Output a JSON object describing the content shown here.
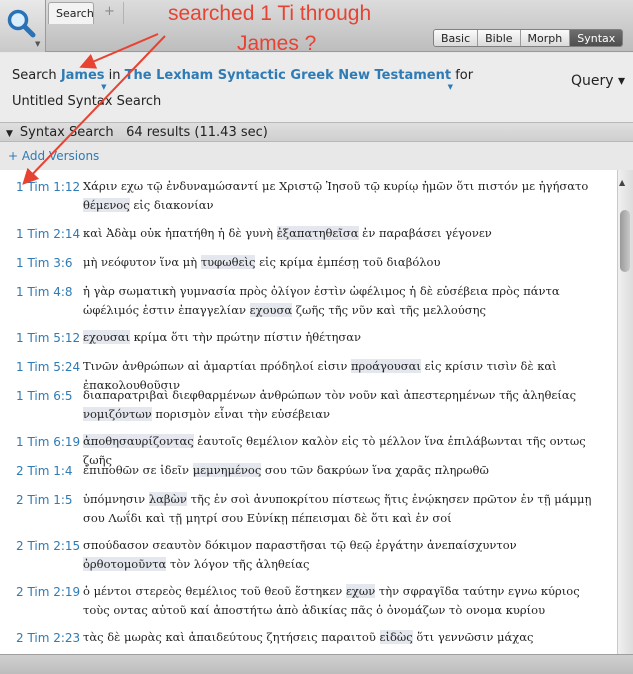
{
  "toolbar": {
    "tab_label": "Search",
    "add_tab": "+",
    "view_modes": [
      "Basic",
      "Bible",
      "Morph",
      "Syntax"
    ],
    "active_view": "Syntax"
  },
  "annotation": {
    "line1": "searched 1 Ti through",
    "line2": "James ?"
  },
  "query": {
    "search_label": "Search",
    "range": "James",
    "in_label": "in",
    "resource": "The Lexham Syntactic Greek New Testament",
    "for_label": "for",
    "query_name": "Untitled Syntax Search",
    "query_menu": "Query ▾"
  },
  "section": {
    "title": "Syntax Search",
    "summary": "64 results (11.43 sec)",
    "add_versions": "+ Add Versions"
  },
  "results": [
    {
      "ref": "1 Tim 1:12",
      "segments": [
        [
          "Χάριν εχω τῷ ἐνδυναμώσαντί με Χριστῷ Ἰησοῦ τῷ κυρίῳ ἡμῶν ὅτι πιστόν με ἡγήσατο ",
          false
        ],
        [
          "θέμενος",
          true
        ],
        [
          " εἰς διακονίαν",
          false
        ]
      ]
    },
    {
      "ref": "1 Tim 2:14",
      "segments": [
        [
          "καὶ Ἀδὰμ οὐκ ἠπατήθη ἡ δὲ γυνὴ ",
          false
        ],
        [
          "ἐξαπατηθεῖσα",
          true
        ],
        [
          " ἐν παραβάσει γέγονεν",
          false
        ]
      ]
    },
    {
      "ref": "1 Tim 3:6",
      "segments": [
        [
          "μὴ νεόφυτον ἵνα μὴ ",
          false
        ],
        [
          "τυφωθεὶς",
          true
        ],
        [
          " εἰς κρίμα ἐμπέσῃ τοῦ διαβόλου",
          false
        ]
      ]
    },
    {
      "ref": "1 Tim 4:8",
      "segments": [
        [
          "ἡ γὰρ σωματικὴ γυμνασία πρὸς ὀλίγον ἐστὶν ὠφέλιμος ἡ δὲ εὐσέβεια πρὸς πάντα ὠφέλιμός ἐστιν ἐπαγγελίαν ",
          false
        ],
        [
          "εχουσα",
          true
        ],
        [
          " ζωῆς τῆς νῦν καὶ τῆς μελλούσης",
          false
        ]
      ]
    },
    {
      "ref": "1 Tim 5:12",
      "segments": [
        [
          "εχουσαι",
          true
        ],
        [
          " κρίμα ὅτι τὴν πρώτην πίστιν ἠθέτησαν",
          false
        ]
      ]
    },
    {
      "ref": "1 Tim 5:24",
      "segments": [
        [
          "Τινῶν ἀνθρώπων αἱ ἁμαρτίαι πρόδηλοί εἰσιν ",
          false
        ],
        [
          "προάγουσαι",
          true
        ],
        [
          " εἰς κρίσιν τισὶν δὲ καὶ ἐπακολουθοῦσιν",
          false
        ]
      ]
    },
    {
      "ref": "1 Tim 6:5",
      "segments": [
        [
          "διαπαρατριβαὶ διεφθαρμένων ἀνθρώπων τὸν νοῦν καὶ ἀπεστερημένων τῆς ἀληθείας ",
          false
        ],
        [
          "νομιζόντων",
          true
        ],
        [
          " πορισμὸν εἶναι τὴν εὐσέβειαν",
          false
        ]
      ]
    },
    {
      "ref": "1 Tim 6:19",
      "segments": [
        [
          "ἀποθησαυρίζοντας",
          true
        ],
        [
          " ἑαυτοῖς θεμέλιον καλὸν εἰς τὸ μέλλον ἵνα ἐπιλάβωνται τῆς οντως ζωῆς",
          false
        ]
      ]
    },
    {
      "ref": "2 Tim 1:4",
      "segments": [
        [
          "ἐπιποθῶν σε ἰδεῖν ",
          false
        ],
        [
          "μεμνημένος",
          true
        ],
        [
          " σου τῶν δακρύων ἵνα χαρᾶς πληρωθῶ",
          false
        ]
      ]
    },
    {
      "ref": "2 Tim 1:5",
      "segments": [
        [
          "ὑπόμνησιν ",
          false
        ],
        [
          "λαβὼν",
          true
        ],
        [
          " τῆς ἐν σοὶ ἀνυποκρίτου πίστεως ἥτις ἐνῴκησεν πρῶτον ἐν τῇ μάμμῃ σου Λωΐδι καὶ τῇ μητρί σου Εὐνίκῃ πέπεισμαι δὲ ὅτι καὶ ἐν σοί",
          false
        ]
      ]
    },
    {
      "ref": "2 Tim 2:15",
      "segments": [
        [
          "σπούδασον σεαυτὸν δόκιμον παραστῆσαι τῷ θεῷ ἐργάτην ἀνεπαίσχυντον ",
          false
        ],
        [
          "ὀρθοτομοῦντα",
          true
        ],
        [
          " τὸν λόγον τῆς ἀληθείας",
          false
        ]
      ]
    },
    {
      "ref": "2 Tim 2:19",
      "segments": [
        [
          "ὁ μέντοι στερεὸς θεμέλιος τοῦ θεοῦ ἕστηκεν ",
          false
        ],
        [
          "εχων",
          true
        ],
        [
          " τὴν σφραγῖδα ταύτην εγνω κύριος τοὺς οντας αὐτοῦ καί ἀποστήτω ἀπὸ ἀδικίας πᾶς ὁ ὀνομάζων τὸ ονομα κυρίου",
          false
        ]
      ]
    },
    {
      "ref": "2 Tim 2:23",
      "segments": [
        [
          "τὰς δὲ μωρὰς καὶ ἀπαιδεύτους ζητήσεις παραιτοῦ ",
          false
        ],
        [
          "εἰδὼς",
          true
        ],
        [
          " ὅτι γεννῶσιν μάχας",
          false
        ]
      ]
    }
  ]
}
